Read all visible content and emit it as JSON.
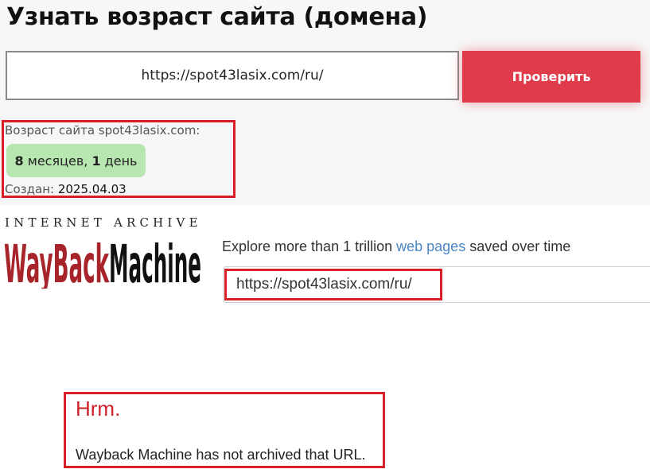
{
  "checker": {
    "title": "Узнать возраст сайта (домена)",
    "url_value": "https://spot43lasix.com/ru/",
    "check_button_label": "Проверить",
    "result": {
      "age_label": "Возраст сайта spot43lasix.com:",
      "months_num": "8",
      "months_word": "месяцев,",
      "days_num": "1",
      "days_word": "день",
      "created_label": "Создан:",
      "created_value": "2025.04.03"
    }
  },
  "wayback": {
    "header_text": "INTERNET ARCHIVE",
    "logo_text_left": "WayBack",
    "logo_text_right": "Machine",
    "explore_prefix": "Explore more than 1 trillion",
    "explore_link": "web pages",
    "explore_suffix": "saved over time",
    "search_value": "https://spot43lasix.com/ru/",
    "error_title": "Hrm.",
    "error_message": "Wayback Machine has not archived that URL."
  },
  "colors": {
    "button_red": "#e03b4a",
    "highlight_red": "#d81f26",
    "badge_green": "#b8e6b0",
    "link_blue": "#4a86c5",
    "logo_red": "#a8242b"
  }
}
